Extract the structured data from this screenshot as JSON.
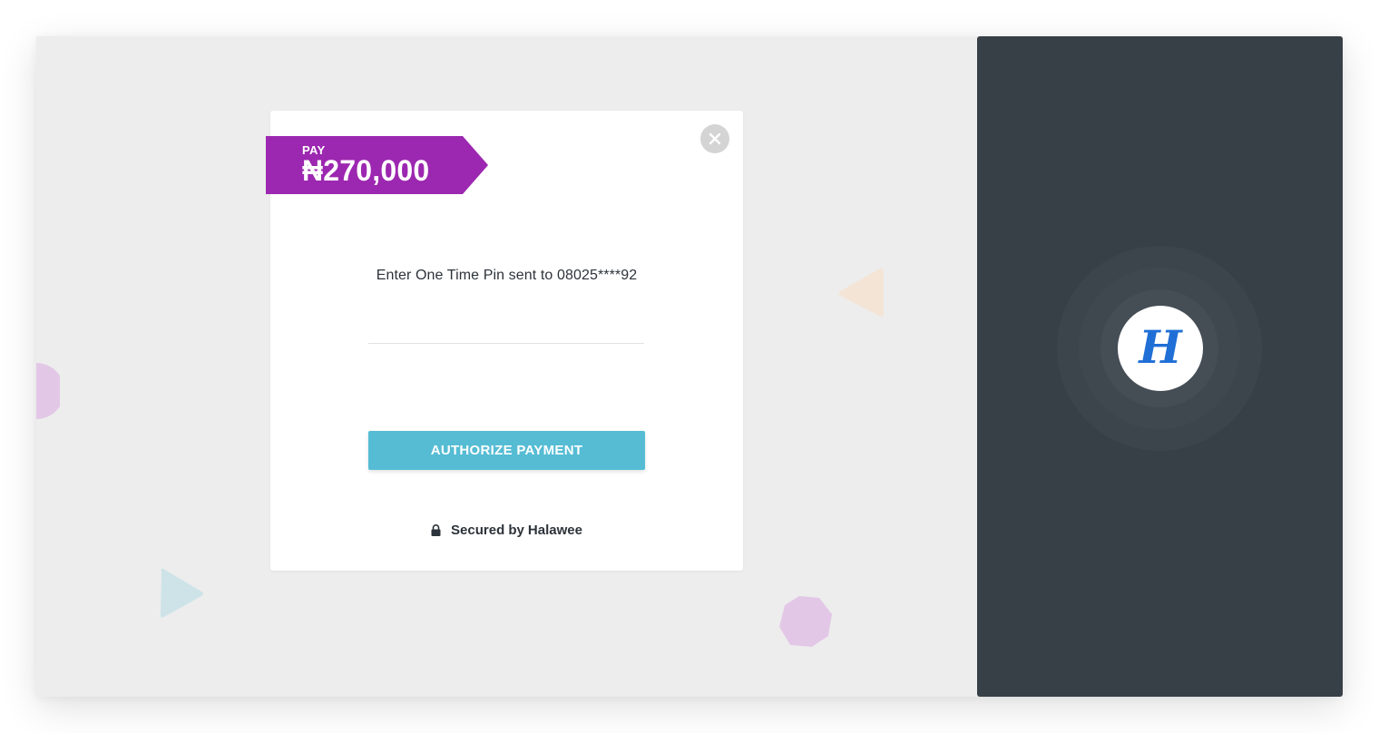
{
  "payment": {
    "pay_label": "PAY",
    "amount": "₦270,000",
    "tag_color": "#9c27b0"
  },
  "otp": {
    "instruction": "Enter One Time Pin sent to 08025****92",
    "input_value": "",
    "input_placeholder": ""
  },
  "actions": {
    "authorize_label": "AUTHORIZE PAYMENT",
    "button_color": "#55bcd4",
    "close_icon": "close-icon"
  },
  "footer": {
    "secured_prefix": "Secured by",
    "brand": "Halawee",
    "lock_icon": "lock-icon"
  },
  "brand_panel": {
    "logo_letter": "H",
    "logo_color": "#1f6fd6",
    "background": "#373f47"
  }
}
